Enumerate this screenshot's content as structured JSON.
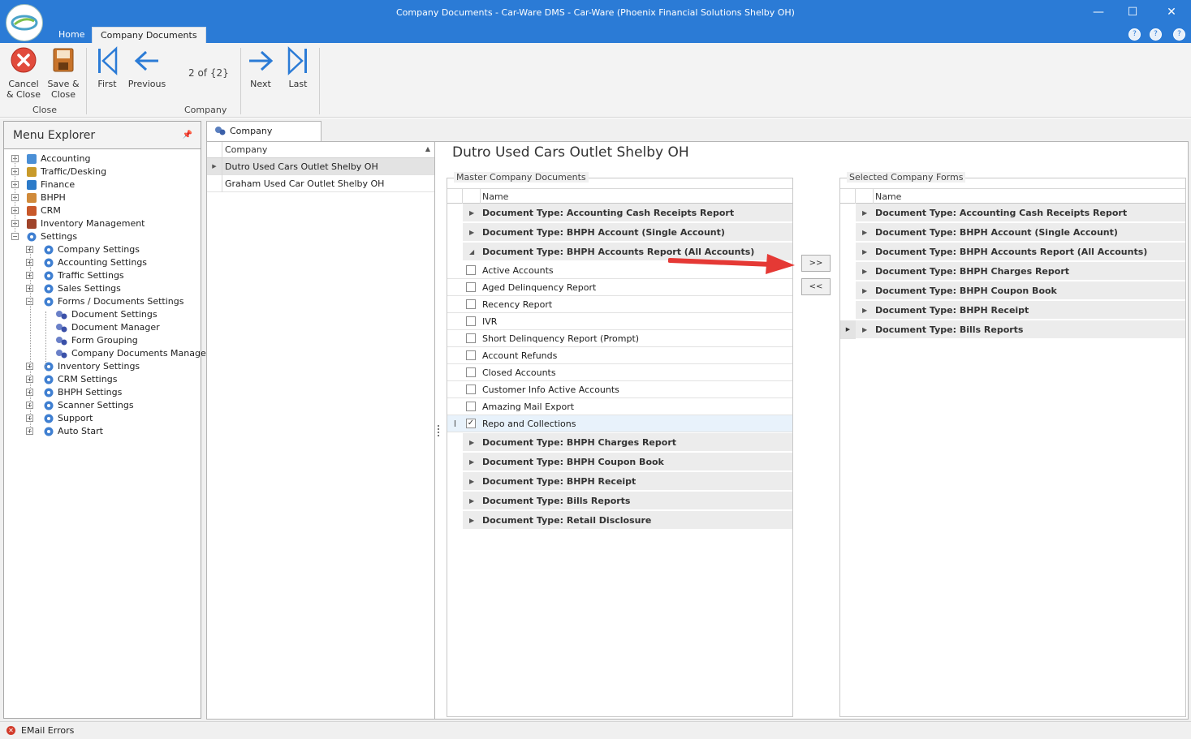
{
  "window": {
    "title": "Company Documents - Car-Ware DMS - Car-Ware (Phoenix Financial Solutions Shelby OH)",
    "minimize": "—",
    "maximize": "☐",
    "close": "✕"
  },
  "ribbon_tabs": [
    "Home",
    "Company Documents"
  ],
  "ribbon": {
    "cancel_close": [
      "Cancel",
      "& Close"
    ],
    "save_close": [
      "Save &",
      "Close"
    ],
    "first": "First",
    "previous": "Previous",
    "record_counter": "2 of {2}",
    "next": "Next",
    "last": "Last",
    "group_close": "Close",
    "group_company": "Company"
  },
  "menu_explorer": {
    "title": "Menu Explorer",
    "items": [
      {
        "label": "Accounting",
        "expander": "+",
        "icon": "calculator-icon"
      },
      {
        "label": "Traffic/Desking",
        "expander": "+",
        "icon": "signpost-icon"
      },
      {
        "label": "Finance",
        "expander": "+",
        "icon": "dollar-icon"
      },
      {
        "label": "BHPH",
        "expander": "+",
        "icon": "handshake-icon"
      },
      {
        "label": "CRM",
        "expander": "+",
        "icon": "crm-icon"
      },
      {
        "label": "Inventory Management",
        "expander": "+",
        "icon": "car-icon"
      },
      {
        "label": "Settings",
        "expander": "−",
        "icon": "gear-icon"
      },
      {
        "label": "Company Settings",
        "expander": "+",
        "icon": "gear-icon"
      },
      {
        "label": "Accounting Settings",
        "expander": "+",
        "icon": "gear-icon"
      },
      {
        "label": "Traffic Settings",
        "expander": "+",
        "icon": "gear-icon"
      },
      {
        "label": "Sales Settings",
        "expander": "+",
        "icon": "gear-icon"
      },
      {
        "label": "Forms / Documents Settings",
        "expander": "−",
        "icon": "gear-icon"
      },
      {
        "label": "Document Settings",
        "expander": "",
        "icon": "gears-small-icon"
      },
      {
        "label": "Document Manager",
        "expander": "",
        "icon": "gears-small-icon"
      },
      {
        "label": "Form Grouping",
        "expander": "",
        "icon": "gears-small-icon"
      },
      {
        "label": "Company Documents Manager",
        "expander": "",
        "icon": "gears-small-icon"
      },
      {
        "label": "Inventory Settings",
        "expander": "+",
        "icon": "gear-icon"
      },
      {
        "label": "CRM Settings",
        "expander": "+",
        "icon": "gear-icon"
      },
      {
        "label": "BHPH Settings",
        "expander": "+",
        "icon": "gear-icon"
      },
      {
        "label": "Scanner Settings",
        "expander": "+",
        "icon": "gear-icon"
      },
      {
        "label": "Support",
        "expander": "+",
        "icon": "gear-icon"
      },
      {
        "label": "Auto Start",
        "expander": "+",
        "icon": "gear-icon"
      }
    ]
  },
  "document_tab": "Company Documents",
  "company_list": {
    "header": "Company",
    "rows": [
      "Dutro Used Cars Outlet Shelby OH",
      "Graham Used Car Outlet Shelby OH"
    ]
  },
  "heading": "Dutro Used Cars Outlet Shelby OH",
  "master": {
    "title": "Master Company Documents",
    "column": "Name",
    "groups_before": [
      "Document Type: Accounting Cash Receipts Report",
      "Document Type: BHPH Account (Single Account)",
      "Document Type: BHPH Accounts Report (All Accounts)"
    ],
    "rows": [
      {
        "label": "Active Accounts",
        "checked": ""
      },
      {
        "label": "Aged Delinquency Report",
        "checked": ""
      },
      {
        "label": "Recency Report",
        "checked": ""
      },
      {
        "label": "IVR",
        "checked": ""
      },
      {
        "label": "Short Delinquency Report (Prompt)",
        "checked": ""
      },
      {
        "label": "Account Refunds",
        "checked": ""
      },
      {
        "label": "Closed Accounts",
        "checked": ""
      },
      {
        "label": "Customer Info Active Accounts",
        "checked": ""
      },
      {
        "label": "Amazing Mail Export",
        "checked": ""
      },
      {
        "label": "Repo and Collections",
        "checked": "✓"
      }
    ],
    "groups_after": [
      "Document Type: BHPH Charges Report",
      "Document Type: BHPH Coupon Book",
      "Document Type: BHPH Receipt",
      "Document Type: Bills Reports",
      "Document Type: Retail Disclosure"
    ]
  },
  "buttons": {
    "add": ">>",
    "remove": "<<"
  },
  "selected": {
    "title": "Selected Company Forms",
    "column": "Name",
    "groups": [
      "Document Type: Accounting Cash Receipts Report",
      "Document Type: BHPH Account (Single Account)",
      "Document Type: BHPH Accounts Report (All Accounts)",
      "Document Type: BHPH Charges Report",
      "Document Type: BHPH Coupon Book",
      "Document Type: BHPH Receipt",
      "Document Type: Bills Reports"
    ]
  },
  "status": {
    "email_errors": "EMail Errors"
  },
  "colors": {
    "titlebar": "#2b7bd6",
    "arrow": "#e53935",
    "cancel": "#e14b3c"
  }
}
